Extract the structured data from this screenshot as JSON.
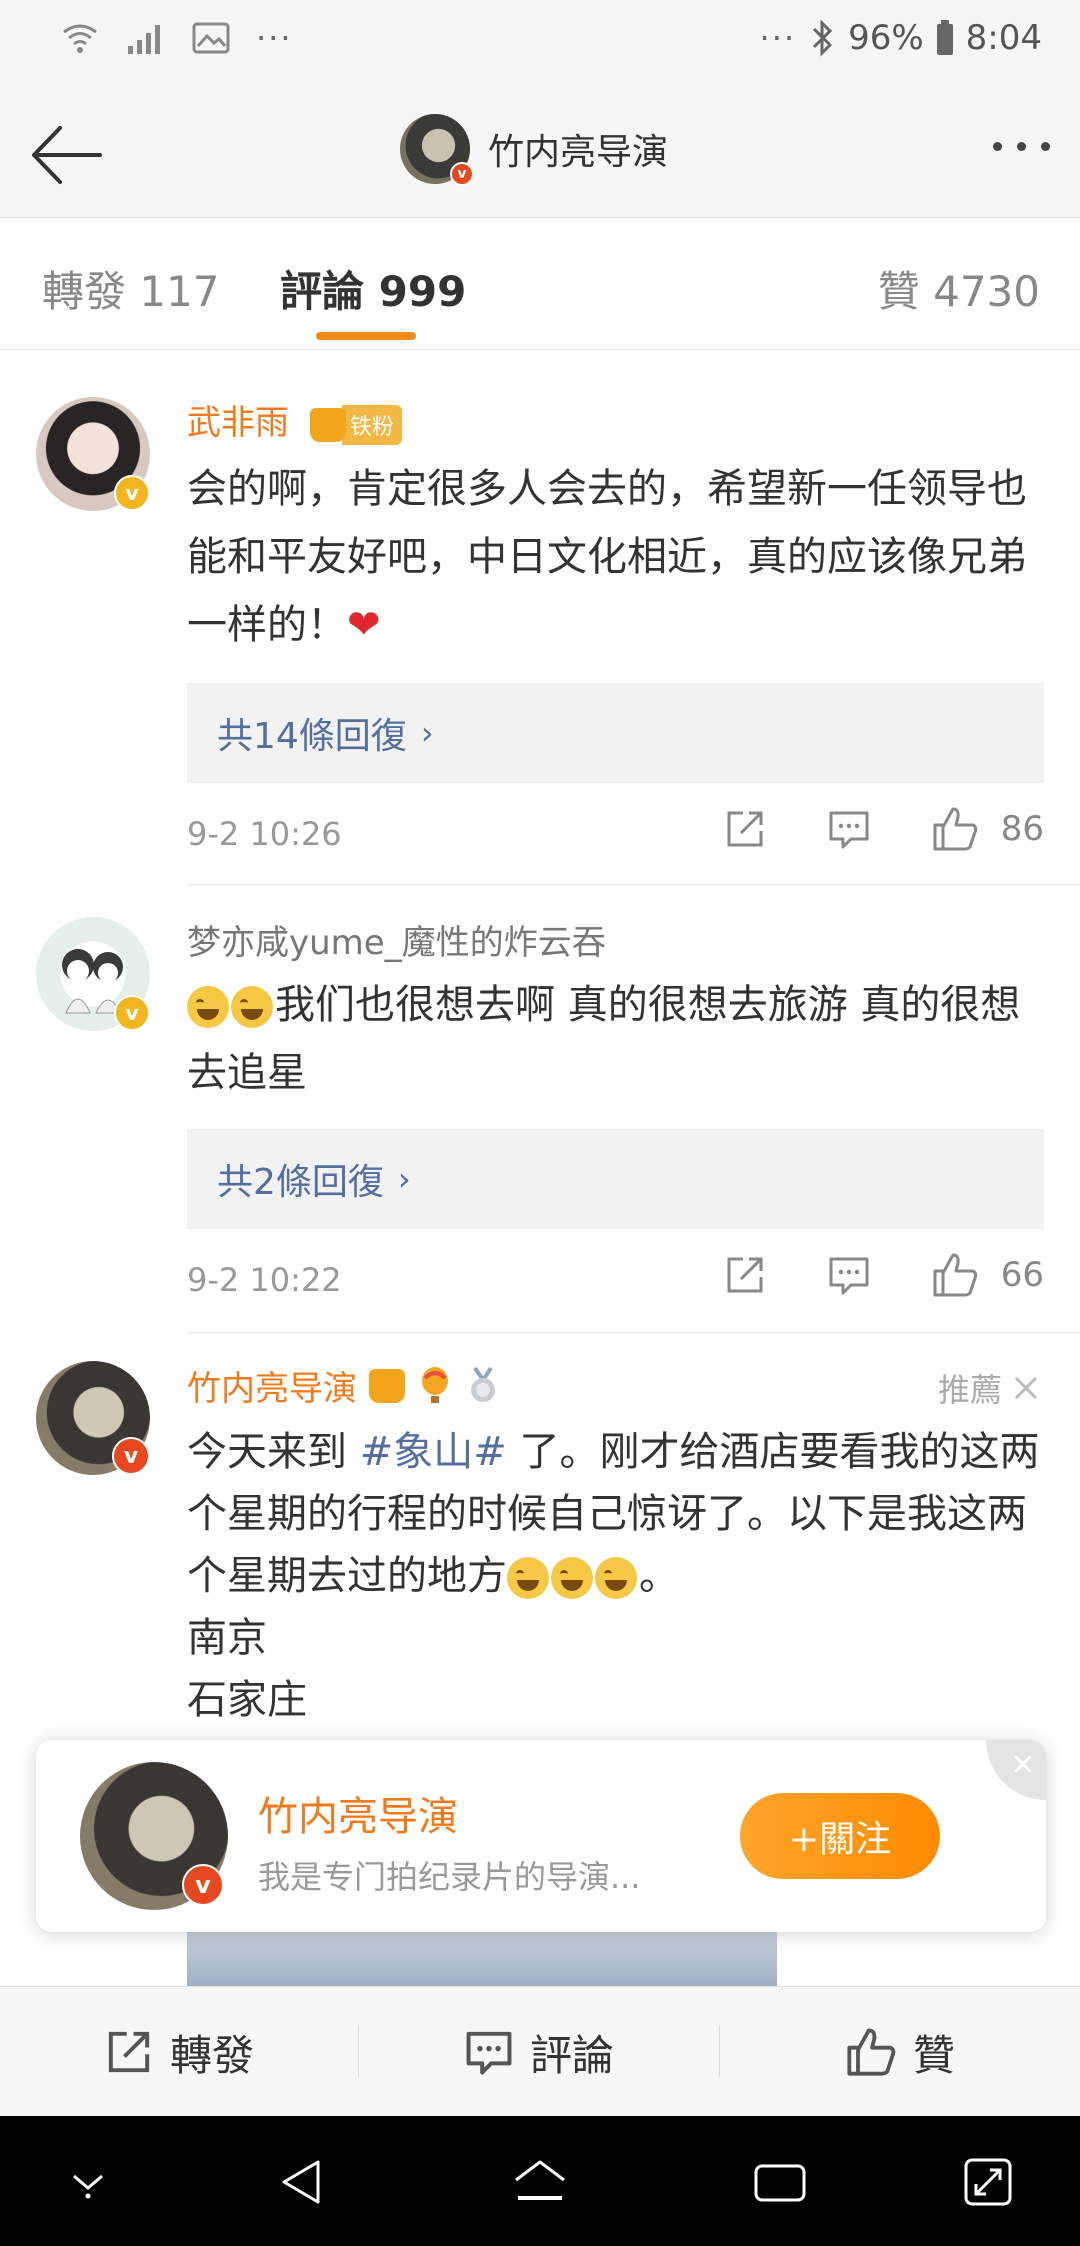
{
  "status_bar": {
    "left_dots": "···",
    "right_dots": "···",
    "battery": "96%",
    "time": "8:04"
  },
  "header": {
    "title": "竹内亮导演"
  },
  "tabs": {
    "reposts": "轉發 117",
    "comments": "評論 999",
    "likes": "贊 4730"
  },
  "comments": [
    {
      "username": "武非雨",
      "fan_badge": "铁粉",
      "text": "会的啊，肯定很多人会去的，希望新一任领导也能和平友好吧，中日文化相近，真的应该像兄弟一样的！",
      "heart": "❤",
      "replies": "共14條回復",
      "time": "9-2 10:26",
      "likes": "86"
    },
    {
      "username": "梦亦咸yume_魔性的炸云吞",
      "text": "我们也很想去啊 真的很想去旅游 真的很想去追星",
      "replies": "共2條回復",
      "time": "9-2 10:22",
      "likes": "66"
    },
    {
      "username": "竹内亮导演",
      "recommend": "推薦",
      "text_before_tag": "今天来到 ",
      "hashtag": "#象山#",
      "text_after_tag": " 了。刚才给酒店要看我的这两个星期的行程的时候自己惊讶了。以下是我这两个星期去过的地方",
      "text_end": "。",
      "line_1": "南京",
      "line_2": "石家庄"
    }
  ],
  "follow_card": {
    "name": "竹内亮导演",
    "description": "我是专门拍纪录片的导演...",
    "follow_label": "+關注"
  },
  "bottom_bar": {
    "repost": "轉發",
    "comment": "評論",
    "like": "贊"
  },
  "colors": {
    "accent_orange": "#f27a1b",
    "link_blue": "#526fa0",
    "follow_button": "#ff9a1a"
  }
}
